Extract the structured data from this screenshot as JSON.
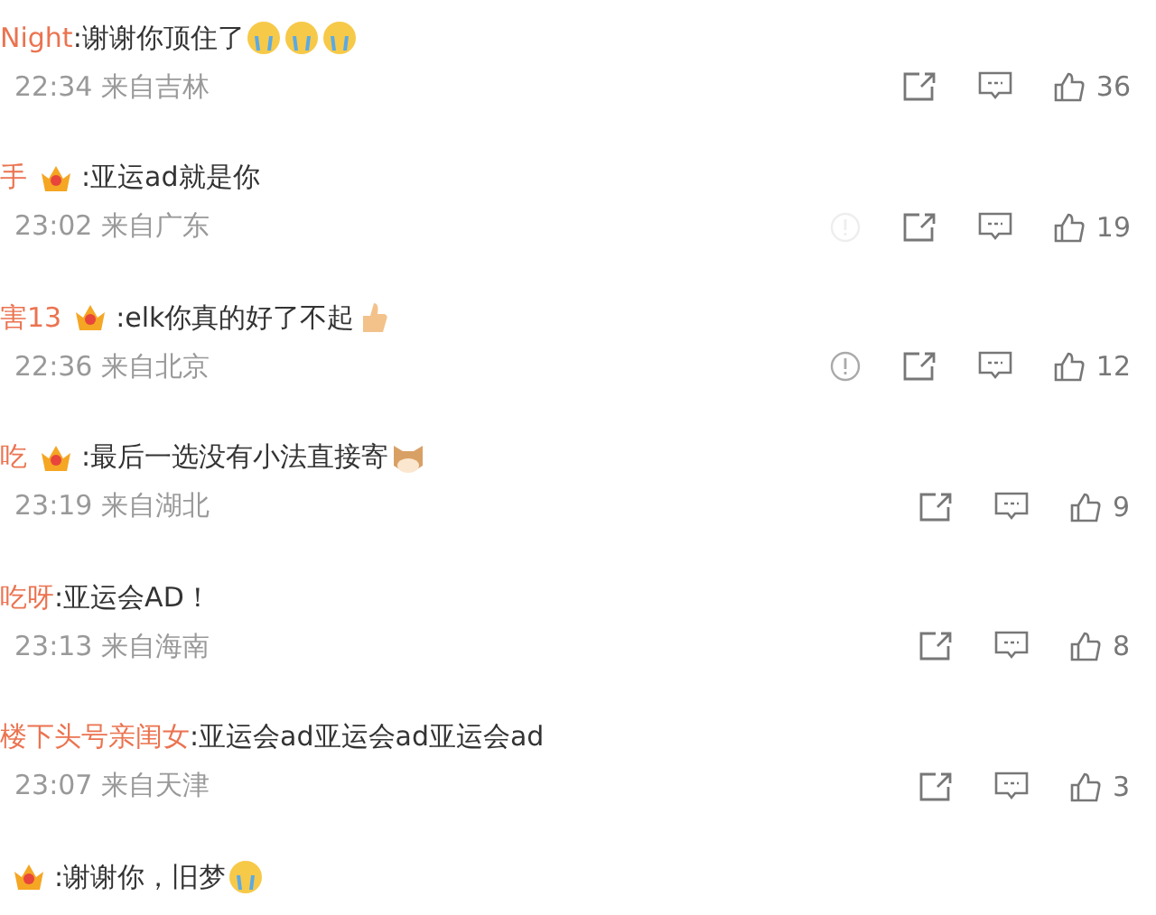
{
  "comments": [
    {
      "name": "Night",
      "badge": false,
      "text": ":谢谢你顶住了",
      "emojis": [
        {
          "kind": "crying"
        },
        {
          "kind": "crying"
        },
        {
          "kind": "crying"
        }
      ],
      "time": "22:34",
      "location": "来自吉林",
      "likes": "36"
    },
    {
      "name": "手",
      "badge": true,
      "text": ":亚运ad就是你",
      "time": "23:02",
      "location": "来自广东",
      "report": {
        "faint": true
      },
      "likes": "19"
    },
    {
      "name": "害13",
      "badge": true,
      "text": ":elk你真的好了不起",
      "emojis": [
        {
          "kind": "thumbs"
        }
      ],
      "time": "22:36",
      "location": "来自北京",
      "report": {
        "faint": false
      },
      "likes": "12"
    },
    {
      "name": "吃",
      "badge": true,
      "text": ":最后一选没有小法直接寄",
      "emojis": [
        {
          "kind": "cat"
        }
      ],
      "time": "23:19",
      "location": "来自湖北",
      "likes": "9"
    },
    {
      "name": "吃呀",
      "badge": false,
      "text": ":亚运会AD！",
      "time": "23:13",
      "location": "来自海南",
      "likes": "8"
    },
    {
      "name": "楼下头号亲闺女",
      "badge": false,
      "text": ":亚运会ad亚运会ad亚运会ad",
      "time": "23:07",
      "location": "来自天津",
      "likes": "3"
    },
    {
      "badge": true,
      "text": ":谢谢你，旧梦",
      "emojis": [
        {
          "kind": "tearful"
        }
      ]
    }
  ]
}
